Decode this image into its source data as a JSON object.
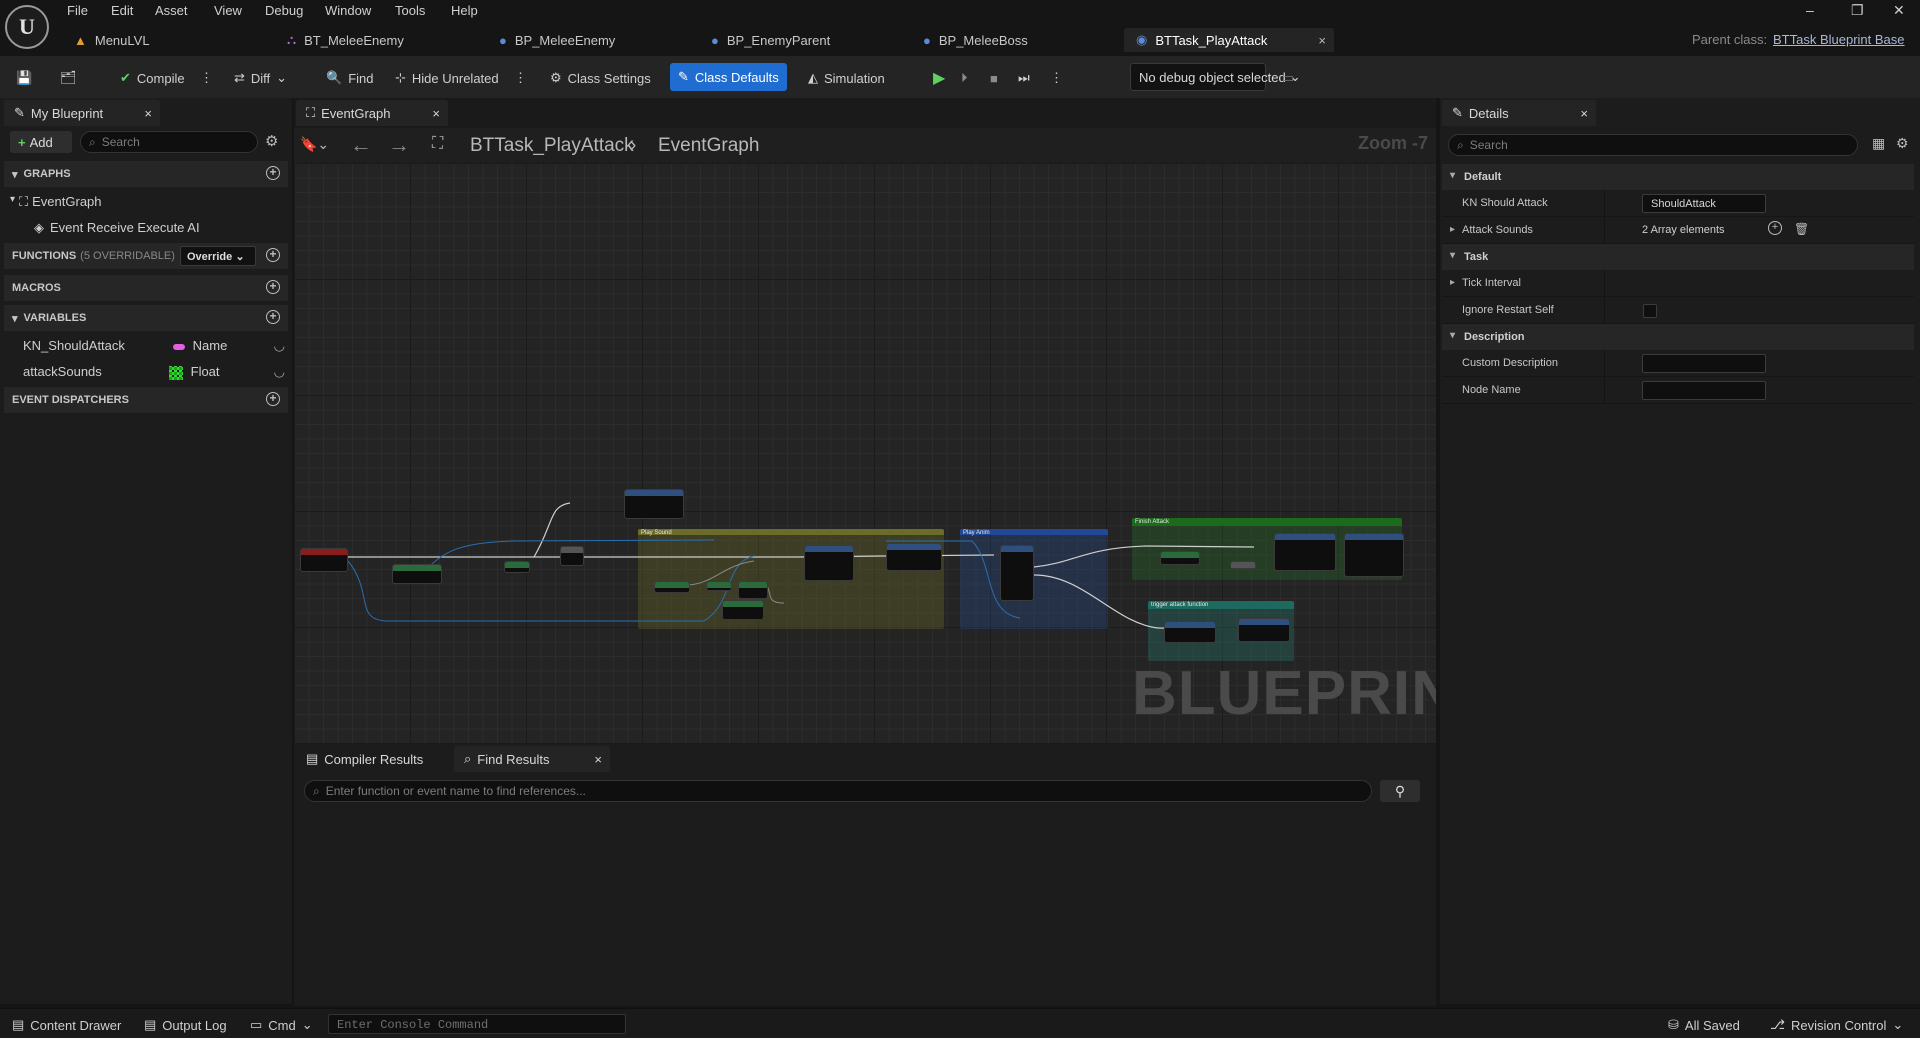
{
  "menu": [
    "File",
    "Edit",
    "Asset",
    "View",
    "Debug",
    "Window",
    "Tools",
    "Help"
  ],
  "tabs": [
    {
      "label": "MenuLVL"
    },
    {
      "label": "BT_MeleeEnemy"
    },
    {
      "label": "BP_MeleeEnemy"
    },
    {
      "label": "BP_EnemyParent"
    },
    {
      "label": "BP_MeleeBoss"
    },
    {
      "label": "BTTask_PlayAttack",
      "active": true
    }
  ],
  "parent_class": {
    "label": "Parent class:",
    "value": "BTTask Blueprint Base"
  },
  "toolbar": {
    "compile": "Compile",
    "diff": "Diff",
    "find": "Find",
    "hide_unrelated": "Hide Unrelated",
    "class_settings": "Class Settings",
    "class_defaults": "Class Defaults",
    "simulation": "Simulation",
    "debug_object": "No debug object selected"
  },
  "my_blueprint": {
    "title": "My Blueprint",
    "add": "Add",
    "search_placeholder": "Search",
    "graphs_header": "GRAPHS",
    "event_graph": "EventGraph",
    "event_item": "Event Receive Execute AI",
    "functions_header": "FUNCTIONS",
    "functions_count": "(5 OVERRIDABLE)",
    "override": "Override",
    "macros_header": "MACROS",
    "variables_header": "VARIABLES",
    "variables": [
      {
        "name": "KN_ShouldAttack",
        "type": "Name",
        "type_color": "#e060e0"
      },
      {
        "name": "attackSounds",
        "type": "Float",
        "type_color": "#3bd13b"
      }
    ],
    "dispatchers_header": "EVENT DISPATCHERS"
  },
  "graph": {
    "tab": "EventGraph",
    "breadcrumb_root": "BTTask_PlayAttack",
    "breadcrumb_leaf": "EventGraph",
    "zoom": "Zoom -7",
    "watermark": "BLUEPRINT",
    "comments": [
      "Play Sound",
      "Play Anim",
      "Finish Attack",
      "trigger attack function"
    ]
  },
  "find_panel": {
    "compiler_results": "Compiler Results",
    "find_results": "Find Results",
    "placeholder": "Enter function or event name to find references..."
  },
  "details": {
    "title": "Details",
    "search_placeholder": "Search",
    "default_header": "Default",
    "kn_label": "KN Should Attack",
    "kn_value": "ShouldAttack",
    "sounds_label": "Attack Sounds",
    "sounds_value": "2 Array elements",
    "task_header": "Task",
    "tick_label": "Tick Interval",
    "ignore_label": "Ignore Restart Self",
    "desc_header": "Description",
    "custom_desc_label": "Custom Description",
    "node_name_label": "Node Name"
  },
  "statusbar": {
    "content_drawer": "Content Drawer",
    "output_log": "Output Log",
    "cmd": "Cmd",
    "console_placeholder": "Enter Console Command",
    "all_saved": "All Saved",
    "revision": "Revision Control"
  }
}
